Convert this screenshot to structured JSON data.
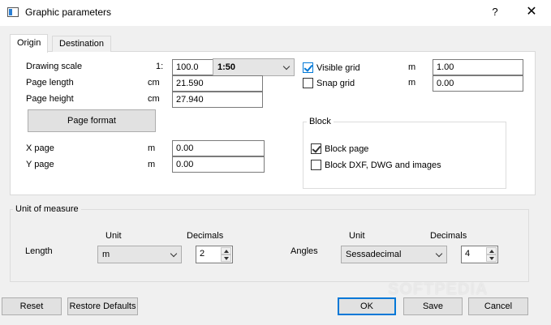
{
  "window": {
    "title": "Graphic parameters",
    "help_label": "?",
    "close_label": "✕"
  },
  "tabs": [
    {
      "label": "Origin"
    },
    {
      "label": "Destination"
    }
  ],
  "origin": {
    "drawing_scale": {
      "label": "Drawing scale",
      "prefix": "1:",
      "value": "100.0",
      "preset": "1:50"
    },
    "page_length": {
      "label": "Page length",
      "unit": "cm",
      "value": "21.590"
    },
    "page_height": {
      "label": "Page height",
      "unit": "cm",
      "value": "27.940"
    },
    "page_format_label": "Page format",
    "x_page": {
      "label": "X page",
      "unit": "m",
      "value": "0.00"
    },
    "y_page": {
      "label": "Y page",
      "unit": "m",
      "value": "0.00"
    },
    "visible_grid": {
      "label": "Visible grid",
      "checked": true,
      "unit": "m",
      "value": "1.00"
    },
    "snap_grid": {
      "label": "Snap grid",
      "checked": false,
      "unit": "m",
      "value": "0.00"
    },
    "block": {
      "title": "Block",
      "block_page": {
        "label": "Block page",
        "checked": true
      },
      "block_dxf": {
        "label": "Block DXF, DWG and images",
        "checked": false
      }
    }
  },
  "unit_of_measure": {
    "title": "Unit of measure",
    "length": {
      "label": "Length",
      "unit_header": "Unit",
      "decimals_header": "Decimals",
      "unit": "m",
      "decimals": "2"
    },
    "angles": {
      "label": "Angles",
      "unit_header": "Unit",
      "decimals_header": "Decimals",
      "unit": "Sessadecimal",
      "decimals": "4"
    }
  },
  "footer": {
    "reset_label": "Reset",
    "restore_label": "Restore Defaults",
    "ok_label": "OK",
    "save_label": "Save",
    "cancel_label": "Cancel"
  },
  "colors": {
    "accent": "#0078d7",
    "panel": "#ffffff",
    "dialog": "#f0f0f0"
  },
  "watermark": "SOFTPEDIA"
}
